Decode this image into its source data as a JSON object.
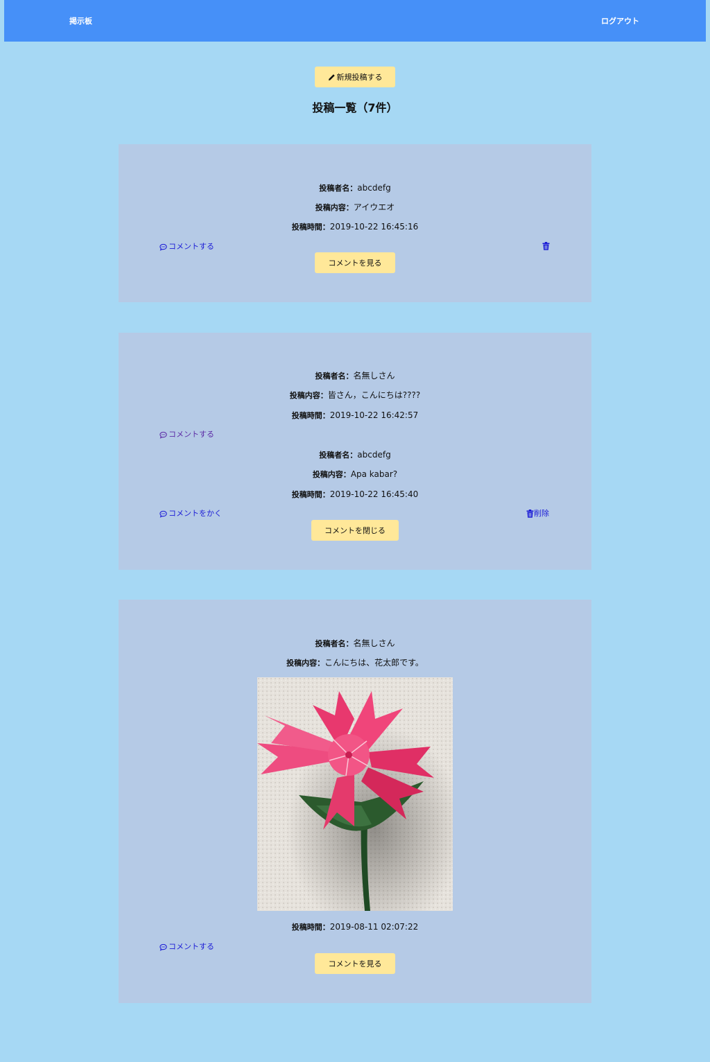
{
  "nav": {
    "brand": "掲示板",
    "logout": "ログアウト"
  },
  "new_post_button": "新規投稿する",
  "list_title": "投稿一覧（7件）",
  "labels": {
    "author": "投稿者名：",
    "content": "投稿内容：",
    "time": "投稿時間："
  },
  "posts": [
    {
      "author": "abcdefg",
      "content": "アイウエオ",
      "time": "2019-10-22 16:45:16",
      "comment_link": "コメントする",
      "toggle_button": "コメントを見る"
    },
    {
      "author": "名無しさん",
      "content": "皆さん，こんにちは????",
      "time": "2019-10-22 16:42:57",
      "comment_link": "コメントする",
      "comment": {
        "author": "abcdefg",
        "content": "Apa kabar?",
        "time": "2019-10-22 16:45:40",
        "write_link": "コメントをかく",
        "delete_link": "削除"
      },
      "toggle_button": "コメントを閉じる"
    },
    {
      "author": "名無しさん",
      "content": "こんにちは、花太郎です。",
      "time": "2019-08-11 02:07:22",
      "comment_link": "コメントする",
      "toggle_button": "コメントを見る"
    }
  ],
  "colors": {
    "background": "#a6d8f4",
    "navbar": "#4690f8",
    "card": "#b5cae6",
    "button": "#ffe899",
    "link": "#1b1bd6"
  }
}
